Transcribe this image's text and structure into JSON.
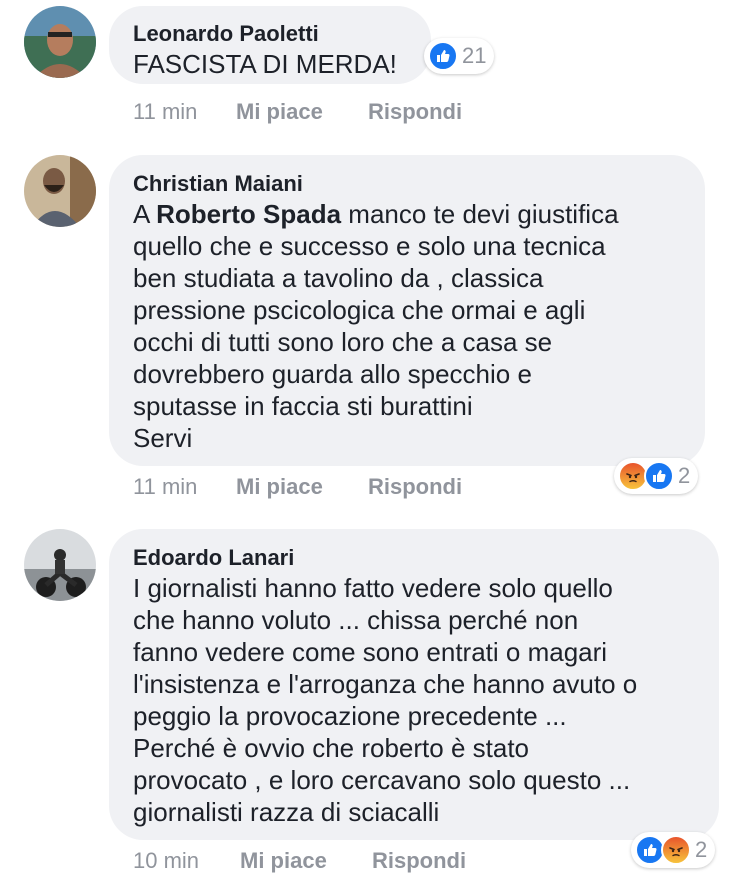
{
  "comments": [
    {
      "author": "Leonardo Paoletti",
      "text": "FASCISTA DI MERDA!",
      "time": "11 min",
      "like_label": "Mi piace",
      "reply_label": "Rispondi",
      "reaction_count": "21",
      "reaction_icons": [
        "like-icon"
      ]
    },
    {
      "author": "Christian Maiani",
      "mention": "Roberto Spada",
      "text_prefix": "A ",
      "text": "  manco te devi giustifica\nquello che e successo e solo una tecnica\nben studiata a tavolino da , classica\npressione pscicologica che ormai e agli\nocchi di tutti sono loro che a casa se\ndovrebbero guarda allo specchio e\nsputasse in faccia sti burattini\nServi",
      "time": "11 min",
      "like_label": "Mi piace",
      "reply_label": "Rispondi",
      "reaction_count": "2",
      "reaction_icons": [
        "angry-icon",
        "like-icon"
      ]
    },
    {
      "author": "Edoardo Lanari",
      "text": "I giornalisti hanno fatto vedere solo quello\nche hanno voluto ... chissa perché non\nfanno vedere come sono entrati o magari\nl'insistenza e l'arroganza che hanno avuto o\npeggio la provocazione precedente ...\nPerché è ovvio che roberto è stato\nprovocato , e loro cercavano solo questo ...\ngiornalisti razza di sciacalli",
      "time": "10 min",
      "like_label": "Mi piace",
      "reply_label": "Rispondi",
      "reaction_count": "2",
      "reaction_icons": [
        "like-icon",
        "angry-icon"
      ]
    }
  ],
  "colors": {
    "bubble": "#f0f1f4",
    "text": "#1d2129",
    "meta": "#90949c",
    "like_blue": "#1877f2"
  }
}
